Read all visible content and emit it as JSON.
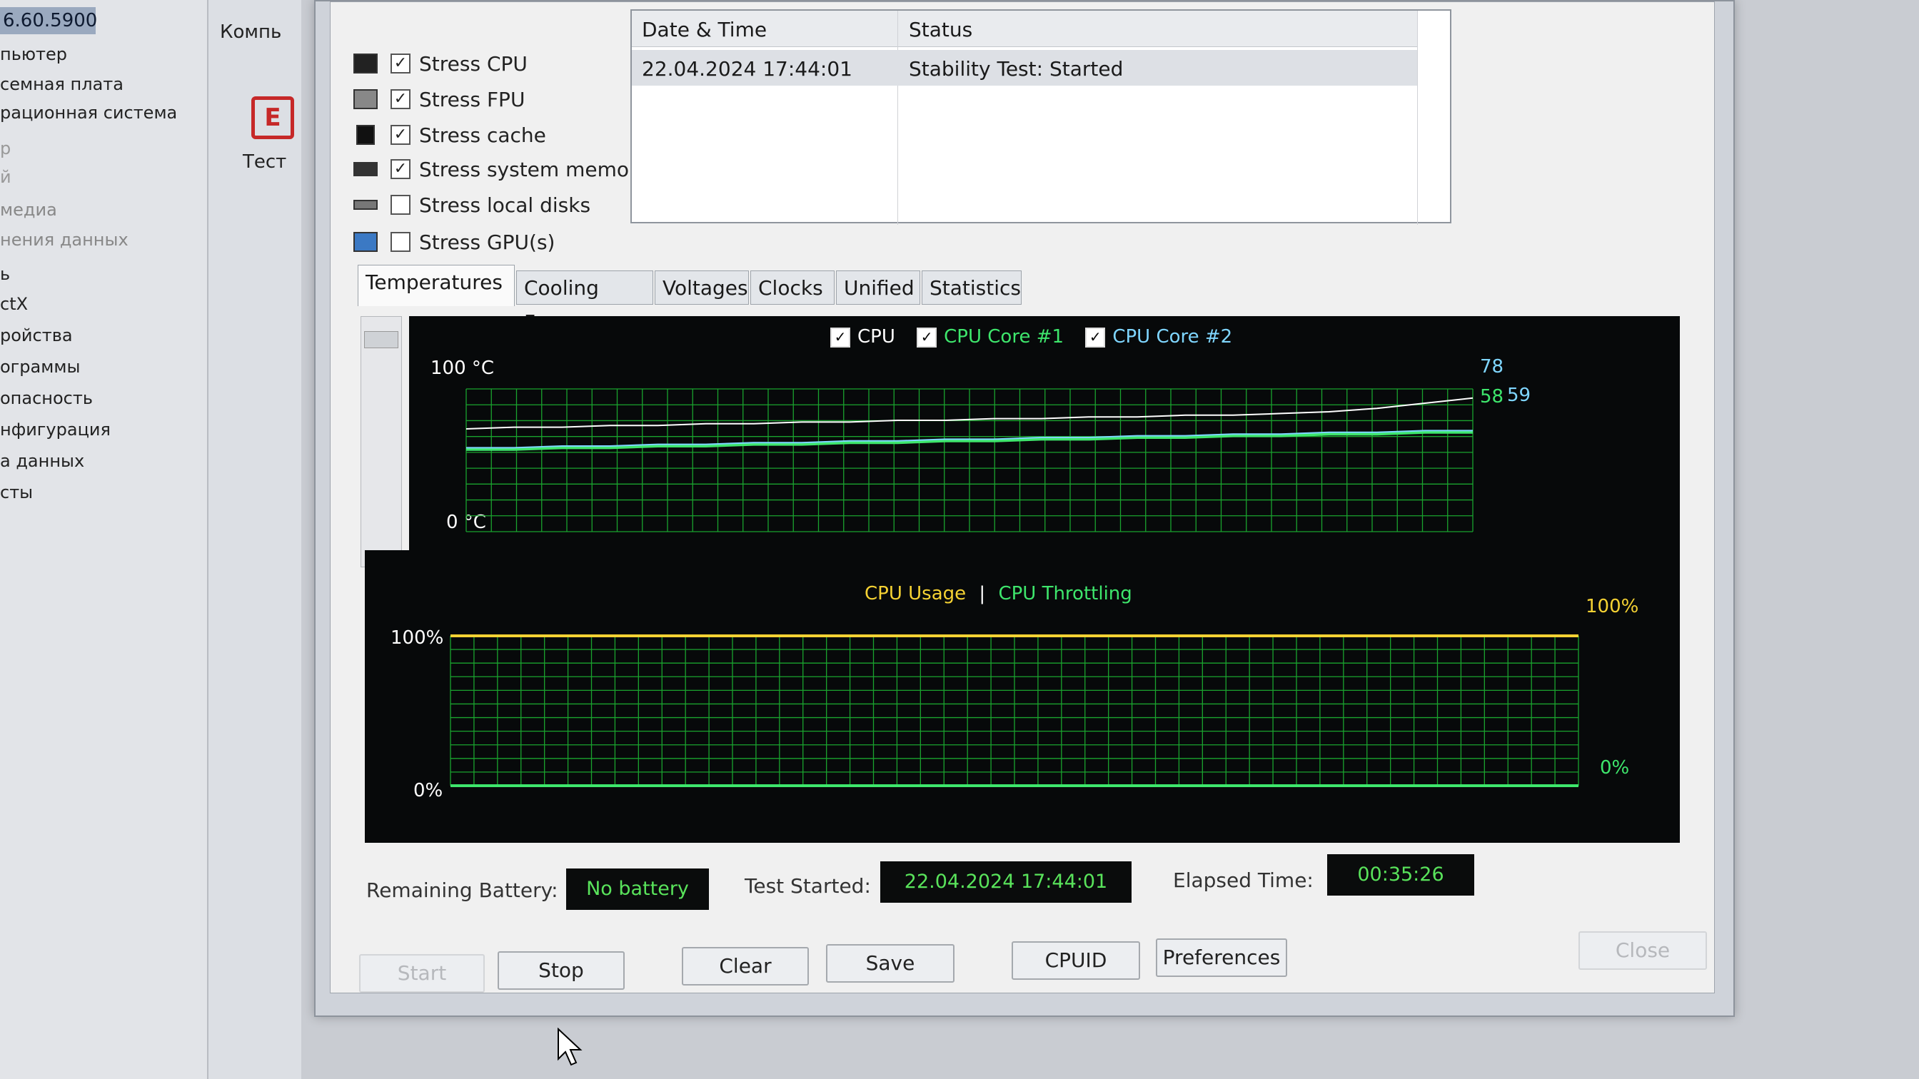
{
  "nav": {
    "version": "6.60.5900",
    "items": [
      "пьютер",
      "семная плата",
      "рационная система",
      "р",
      "й",
      "медиа",
      "нения данных",
      "ь",
      "ctX",
      "ройства",
      "ограммы",
      "опасность",
      "нфигурация",
      "а данных",
      "сты"
    ]
  },
  "side": {
    "top_label": "Компь",
    "test_label": "Тест"
  },
  "stress": [
    {
      "label": "Stress CPU",
      "checked": true,
      "icon": "cpu-chip-icon"
    },
    {
      "label": "Stress FPU",
      "checked": true,
      "icon": "fpu-icon"
    },
    {
      "label": "Stress cache",
      "checked": true,
      "icon": "cache-icon"
    },
    {
      "label": "Stress system memory",
      "checked": true,
      "icon": "memory-icon"
    },
    {
      "label": "Stress local disks",
      "checked": false,
      "icon": "disk-icon"
    },
    {
      "label": "Stress GPU(s)",
      "checked": false,
      "icon": "monitor-icon"
    }
  ],
  "log": {
    "headers": [
      "Date & Time",
      "Status"
    ],
    "rows": [
      {
        "datetime": "22.04.2024 17:44:01",
        "status": "Stability Test: Started"
      }
    ]
  },
  "tabs": [
    "Temperatures",
    "Cooling Fans",
    "Voltages",
    "Clocks",
    "Unified",
    "Statistics"
  ],
  "active_tab": "Temperatures",
  "temp_chart": {
    "legend": [
      {
        "label": "CPU",
        "color": "#ffffff"
      },
      {
        "label": "CPU Core #1",
        "color": "#3ee66c"
      },
      {
        "label": "CPU Core #2",
        "color": "#7fd6ff"
      }
    ],
    "y_top": "100 °C",
    "y_bottom": "0 °C",
    "end_values": {
      "a": "78",
      "b": "58",
      "c": "59"
    },
    "grid_color": "#1aa32e"
  },
  "chart_data": [
    {
      "type": "line",
      "title": "",
      "ylabel": "",
      "ylim": [
        0,
        100
      ],
      "series": [
        {
          "name": "CPU",
          "values": [
            60,
            61,
            61,
            62,
            62,
            63,
            63,
            64,
            64,
            65,
            65,
            66,
            66,
            67,
            67,
            68,
            68,
            69,
            70,
            72,
            75,
            78
          ]
        },
        {
          "name": "CPU Core #1",
          "values": [
            48,
            48,
            49,
            49,
            50,
            50,
            51,
            51,
            52,
            52,
            53,
            53,
            54,
            54,
            55,
            55,
            56,
            56,
            57,
            57,
            58,
            58
          ]
        },
        {
          "name": "CPU Core #2",
          "values": [
            49,
            49,
            50,
            50,
            51,
            51,
            52,
            52,
            53,
            53,
            54,
            54,
            55,
            55,
            56,
            56,
            57,
            57,
            58,
            58,
            59,
            59
          ]
        }
      ]
    },
    {
      "type": "line",
      "title": "CPU Usage | CPU Throttling",
      "ylim": [
        0,
        100
      ],
      "series": [
        {
          "name": "CPU Usage",
          "values": [
            100,
            100,
            100,
            100,
            100,
            100,
            100,
            100,
            100,
            100,
            100,
            100,
            100,
            100,
            100,
            100,
            100,
            100,
            100,
            100,
            100,
            100
          ]
        },
        {
          "name": "CPU Throttling",
          "values": [
            0,
            0,
            0,
            0,
            0,
            0,
            0,
            0,
            0,
            0,
            0,
            0,
            0,
            0,
            0,
            0,
            0,
            0,
            0,
            0,
            0,
            0
          ]
        }
      ]
    }
  ],
  "usage_chart": {
    "title_usage": "CPU Usage",
    "title_sep": "|",
    "title_throttle": "CPU Throttling",
    "usage_color": "#f5d233",
    "throttle_color": "#3ee66c",
    "y_top": "100%",
    "y_bottom": "0%",
    "end_top": "100%",
    "end_bottom": "0%"
  },
  "status": {
    "battery_label": "Remaining Battery:",
    "battery_value": "No battery",
    "started_label": "Test Started:",
    "started_value": "22.04.2024 17:44:01",
    "elapsed_label": "Elapsed Time:",
    "elapsed_value": "00:35:26"
  },
  "buttons": {
    "start": "Start",
    "stop": "Stop",
    "clear": "Clear",
    "save": "Save",
    "cpuid": "CPUID",
    "preferences": "Preferences",
    "close": "Close"
  }
}
